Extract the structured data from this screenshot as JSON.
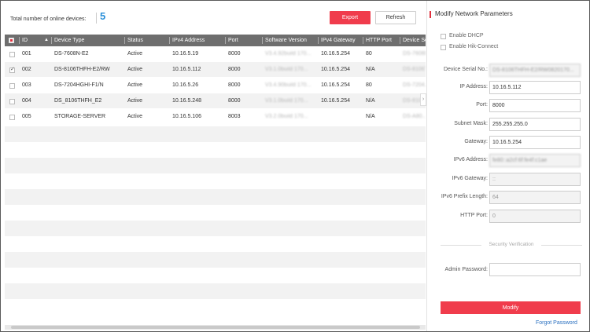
{
  "toolbar": {
    "count_label": "Total number of online devices:",
    "count_value": "5",
    "export_label": "Export",
    "refresh_label": "Refresh"
  },
  "table": {
    "headers": [
      "ID",
      "Device Type",
      "Status",
      "IPv4 Address",
      "Port",
      "Software Version",
      "IPv4 Gateway",
      "HTTP Port",
      "Device Se..."
    ],
    "rows": [
      {
        "checked": false,
        "id": "001",
        "type": "DS-7608N-E2",
        "status": "Active",
        "ip": "10.16.5.19",
        "port": "8000",
        "sw": "V3.4.92build 170...",
        "gw": "10.16.5.254",
        "http": "80",
        "serial": "DS-7608N..."
      },
      {
        "checked": true,
        "id": "002",
        "type": "DS-8106THFH-E2/RW",
        "status": "Active",
        "ip": "10.16.5.112",
        "port": "8000",
        "sw": "V3.1.0build 170...",
        "gw": "10.16.5.254",
        "http": "N/A",
        "serial": "DS-8106T..."
      },
      {
        "checked": false,
        "id": "003",
        "type": "DS-7204HGHI-F1/N",
        "status": "Active",
        "ip": "10.16.5.26",
        "port": "8000",
        "sw": "V3.4.90build 170...",
        "gw": "10.16.5.254",
        "http": "80",
        "serial": "DS-7204..."
      },
      {
        "checked": false,
        "id": "004",
        "type": "DS_8106THFH_E2",
        "status": "Active",
        "ip": "10.16.5.248",
        "port": "8000",
        "sw": "V3.1.0build 170...",
        "gw": "10.16.5.254",
        "http": "N/A",
        "serial": "DS-8106..."
      },
      {
        "checked": false,
        "id": "005",
        "type": "STORAGE-SERVER",
        "status": "Active",
        "ip": "10.16.5.106",
        "port": "8003",
        "sw": "V3.2.0build 170...",
        "gw": "",
        "http": "N/A",
        "serial": "DS-A80..."
      }
    ]
  },
  "panel": {
    "title": "Modify Network Parameters",
    "enable_dhcp": "Enable DHCP",
    "enable_hik": "Enable Hik-Connect",
    "fields": {
      "serial_label": "Device Serial No.:",
      "serial_value": "DS-8106THFH-E2/RW0820170...",
      "ip_label": "IP Address:",
      "ip_value": "10.16.5.112",
      "port_label": "Port:",
      "port_value": "8000",
      "mask_label": "Subnet Mask:",
      "mask_value": "255.255.255.0",
      "gateway_label": "Gateway:",
      "gateway_value": "10.16.5.254",
      "ipv6_label": "IPv6 Address:",
      "ipv6_value": "fe80::a2cf:6f:fe4f:c1ae",
      "ipv6gw_label": "IPv6 Gateway:",
      "ipv6gw_value": "::",
      "prefix_label": "IPv6 Prefix Length:",
      "prefix_value": "64",
      "http_label": "HTTP Port:",
      "http_value": "0"
    },
    "security_title": "Security Verification",
    "admin_label": "Admin Password:",
    "admin_value": "",
    "modify_label": "Modify",
    "forgot_label": "Forgot Password"
  },
  "colors": {
    "accent_red": "#f03c4c",
    "count_blue": "#2a8fd8",
    "header_gray": "#6e6e6e",
    "link_blue": "#2a70c0"
  }
}
